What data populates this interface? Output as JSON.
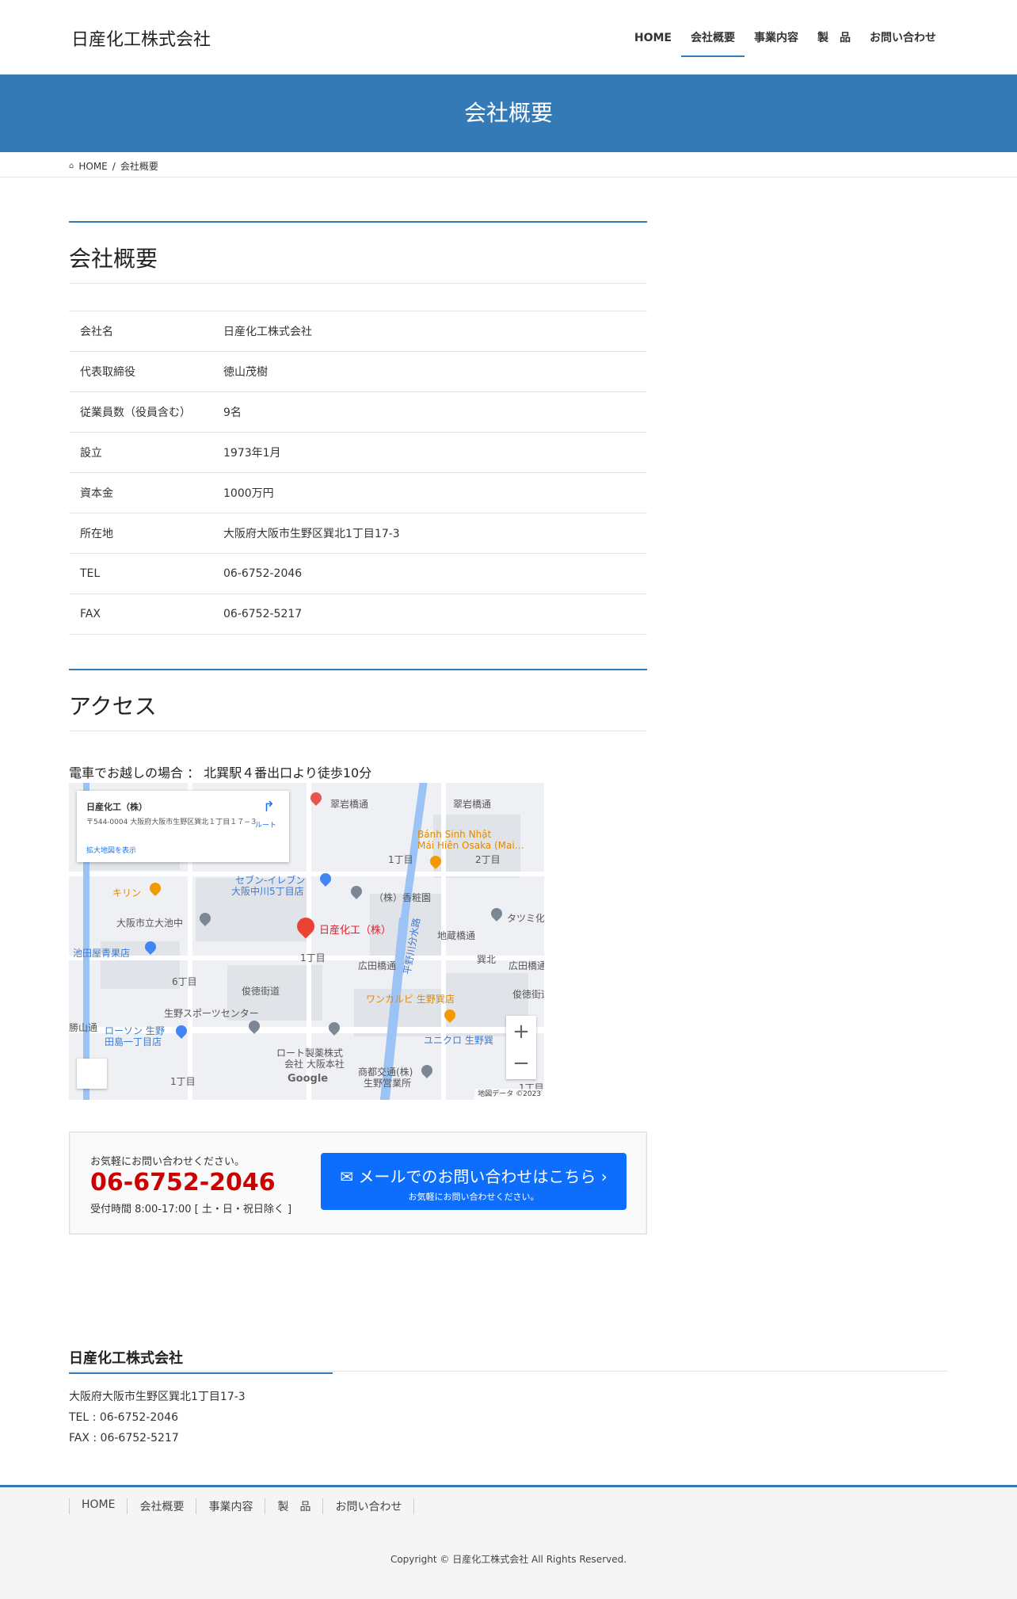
{
  "header": {
    "logo": "日産化工株式会社",
    "nav": [
      "HOME",
      "会社概要",
      "事業内容",
      "製　品",
      "お問い合わせ"
    ]
  },
  "banner": {
    "title": "会社概要"
  },
  "breadcrumb": {
    "home": "HOME",
    "current": "会社概要"
  },
  "company": {
    "title": "会社概要",
    "rows": [
      {
        "k": "会社名",
        "v": "日産化工株式会社"
      },
      {
        "k": "代表取締役",
        "v": "徳山茂樹"
      },
      {
        "k": "従業員数（役員含む）",
        "v": "9名"
      },
      {
        "k": "設立",
        "v": "1973年1月"
      },
      {
        "k": "資本金",
        "v": "1000万円"
      },
      {
        "k": "所在地",
        "v": "大阪府大阪市生野区巽北1丁目17-3"
      },
      {
        "k": "TEL",
        "v": "06-6752-2046"
      },
      {
        "k": "FAX",
        "v": "06-6752-5217"
      }
    ]
  },
  "access": {
    "title": "アクセス",
    "text": "電車でお越しの場合 ： 北巽駅４番出口より徒歩10分",
    "map": {
      "card_title": "日産化工（株）",
      "card_address": "〒544-0004 大阪府大阪市生野区巽北１丁目１７−３",
      "card_link": "拡大地図を表示",
      "directions": "ルート",
      "labels": {
        "pin": "日産化工（株）",
        "l1": "翠岩橋通",
        "l2": "翠岩橋通",
        "l3": "Bánh Sinh Nhật",
        "l4": "Mái Hiên Osaka (Mai…",
        "l5": "1丁目",
        "l6": "2丁目",
        "l7": "セブン-イレブン",
        "l8": "大阪中川5丁目店",
        "l9": "（株）香粧園",
        "l10": "キリン",
        "l11": "大阪市立大池中",
        "l12": "タツミ化",
        "l13": "地蔵橋通",
        "l14": "池田屋青果店",
        "l15": "1丁目",
        "l16": "広田橋通",
        "l17": "巽北",
        "l18": "広田橋通",
        "l19": "6丁目",
        "l20": "俊徳街道",
        "l21": "ワンカルビ 生野巽店",
        "l22": "俊徳街道",
        "l23": "生野スポーツセンター",
        "l24": "勝山通",
        "l25": "ローソン 生野",
        "l26": "田島一丁目店",
        "l27": "ユニクロ 生野巽",
        "l28": "ロート製薬株式",
        "l29": "会社 大阪本社",
        "l30": "商都交通(株)",
        "l31": "生野営業所",
        "l32": "1丁目",
        "l33": "1丁目",
        "l34": "平野川分水路",
        "google": "Google",
        "attrib": "地図データ ©2023"
      }
    }
  },
  "contact": {
    "small": "お気軽にお問い合わせください。",
    "tel": "06-6752-2046",
    "hours": "受付時間 8:00-17:00 [ 土・日・祝日除く ]",
    "mail_main": "メールでのお問い合わせはこちら",
    "mail_sub": "お気軽にお問い合わせください。"
  },
  "footer": {
    "title": "日産化工株式会社",
    "address": "大阪府大阪市生野区巽北1丁目17-3",
    "tel": "TEL : 06-6752-2046",
    "fax": "FAX : 06-6752-5217",
    "nav": [
      "HOME",
      "会社概要",
      "事業内容",
      "製　品",
      "お問い合わせ"
    ],
    "copyright": "Copyright © 日産化工株式会社 All Rights Reserved."
  }
}
